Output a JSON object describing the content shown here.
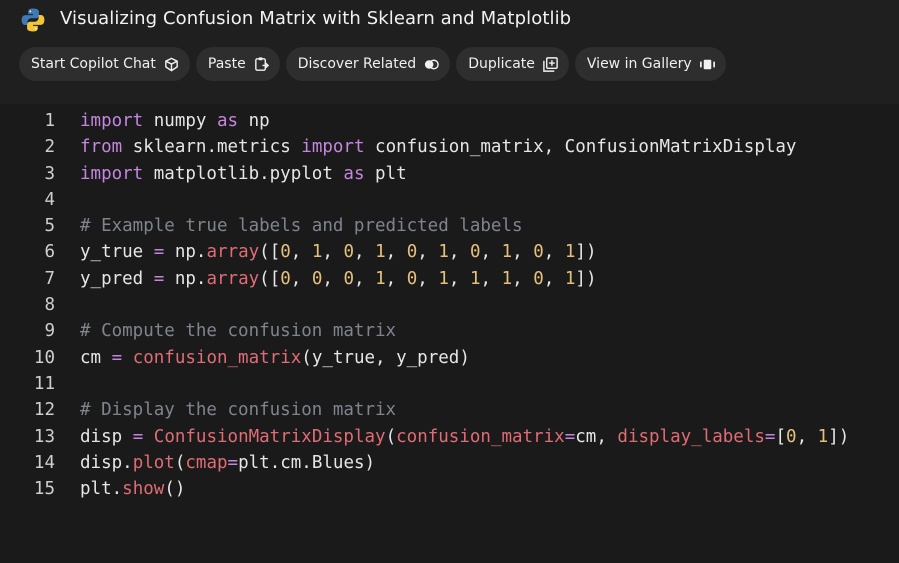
{
  "header": {
    "title": "Visualizing Confusion Matrix with Sklearn and Matplotlib",
    "logo_icon": "python-logo-icon"
  },
  "toolbar": {
    "buttons": [
      {
        "label": "Start Copilot Chat",
        "icon": "copilot-chat-icon"
      },
      {
        "label": "Paste",
        "icon": "paste-icon"
      },
      {
        "label": "Discover Related",
        "icon": "discover-icon"
      },
      {
        "label": "Duplicate",
        "icon": "duplicate-icon"
      },
      {
        "label": "View in Gallery",
        "icon": "gallery-icon"
      }
    ]
  },
  "code": {
    "language": "python",
    "lines": [
      {
        "n": "1",
        "tokens": [
          [
            "kw",
            "import"
          ],
          [
            "t",
            " numpy "
          ],
          [
            "kw",
            "as"
          ],
          [
            "t",
            " np"
          ]
        ]
      },
      {
        "n": "2",
        "tokens": [
          [
            "kw",
            "from"
          ],
          [
            "t",
            " sklearn.metrics "
          ],
          [
            "kw",
            "import"
          ],
          [
            "t",
            " confusion_matrix, ConfusionMatrixDisplay"
          ]
        ]
      },
      {
        "n": "3",
        "tokens": [
          [
            "kw",
            "import"
          ],
          [
            "t",
            " matplotlib.pyplot "
          ],
          [
            "kw",
            "as"
          ],
          [
            "t",
            " plt"
          ]
        ]
      },
      {
        "n": "4",
        "tokens": []
      },
      {
        "n": "5",
        "tokens": [
          [
            "cm",
            "# Example true labels and predicted labels"
          ]
        ]
      },
      {
        "n": "6",
        "tokens": [
          [
            "t",
            "y_true "
          ],
          [
            "eq",
            "="
          ],
          [
            "t",
            " np."
          ],
          [
            "fn",
            "array"
          ],
          [
            "t",
            "(["
          ],
          [
            "num",
            "0"
          ],
          [
            "t",
            ", "
          ],
          [
            "num",
            "1"
          ],
          [
            "t",
            ", "
          ],
          [
            "num",
            "0"
          ],
          [
            "t",
            ", "
          ],
          [
            "num",
            "1"
          ],
          [
            "t",
            ", "
          ],
          [
            "num",
            "0"
          ],
          [
            "t",
            ", "
          ],
          [
            "num",
            "1"
          ],
          [
            "t",
            ", "
          ],
          [
            "num",
            "0"
          ],
          [
            "t",
            ", "
          ],
          [
            "num",
            "1"
          ],
          [
            "t",
            ", "
          ],
          [
            "num",
            "0"
          ],
          [
            "t",
            ", "
          ],
          [
            "num",
            "1"
          ],
          [
            "t",
            "])"
          ]
        ]
      },
      {
        "n": "7",
        "tokens": [
          [
            "t",
            "y_pred "
          ],
          [
            "eq",
            "="
          ],
          [
            "t",
            " np."
          ],
          [
            "fn",
            "array"
          ],
          [
            "t",
            "(["
          ],
          [
            "num",
            "0"
          ],
          [
            "t",
            ", "
          ],
          [
            "num",
            "0"
          ],
          [
            "t",
            ", "
          ],
          [
            "num",
            "0"
          ],
          [
            "t",
            ", "
          ],
          [
            "num",
            "1"
          ],
          [
            "t",
            ", "
          ],
          [
            "num",
            "0"
          ],
          [
            "t",
            ", "
          ],
          [
            "num",
            "1"
          ],
          [
            "t",
            ", "
          ],
          [
            "num",
            "1"
          ],
          [
            "t",
            ", "
          ],
          [
            "num",
            "1"
          ],
          [
            "t",
            ", "
          ],
          [
            "num",
            "0"
          ],
          [
            "t",
            ", "
          ],
          [
            "num",
            "1"
          ],
          [
            "t",
            "])"
          ]
        ]
      },
      {
        "n": "8",
        "tokens": []
      },
      {
        "n": "9",
        "tokens": [
          [
            "cm",
            "# Compute the confusion matrix"
          ]
        ]
      },
      {
        "n": "10",
        "tokens": [
          [
            "t",
            "cm "
          ],
          [
            "eq",
            "="
          ],
          [
            "t",
            " "
          ],
          [
            "fn",
            "confusion_matrix"
          ],
          [
            "t",
            "(y_true, y_pred)"
          ]
        ]
      },
      {
        "n": "11",
        "tokens": []
      },
      {
        "n": "12",
        "tokens": [
          [
            "cm",
            "# Display the confusion matrix"
          ]
        ]
      },
      {
        "n": "13",
        "tokens": [
          [
            "t",
            "disp "
          ],
          [
            "eq",
            "="
          ],
          [
            "t",
            " "
          ],
          [
            "fn",
            "ConfusionMatrixDisplay"
          ],
          [
            "t",
            "("
          ],
          [
            "fn",
            "confusion_matrix"
          ],
          [
            "eq",
            "="
          ],
          [
            "t",
            "cm, "
          ],
          [
            "fn",
            "display_labels"
          ],
          [
            "eq",
            "="
          ],
          [
            "t",
            "["
          ],
          [
            "num",
            "0"
          ],
          [
            "t",
            ", "
          ],
          [
            "num",
            "1"
          ],
          [
            "t",
            "])"
          ]
        ]
      },
      {
        "n": "14",
        "tokens": [
          [
            "t",
            "disp."
          ],
          [
            "fn",
            "plot"
          ],
          [
            "t",
            "("
          ],
          [
            "fn",
            "cmap"
          ],
          [
            "eq",
            "="
          ],
          [
            "t",
            "plt.cm.Blues)"
          ]
        ]
      },
      {
        "n": "15",
        "tokens": [
          [
            "t",
            "plt."
          ],
          [
            "fn",
            "show"
          ],
          [
            "t",
            "()"
          ]
        ]
      }
    ]
  },
  "colors": {
    "background": "#1f1f1f",
    "keyword": "#c586e0",
    "comment": "#7f848e",
    "number": "#e5c07b",
    "function": "#e06c75"
  }
}
